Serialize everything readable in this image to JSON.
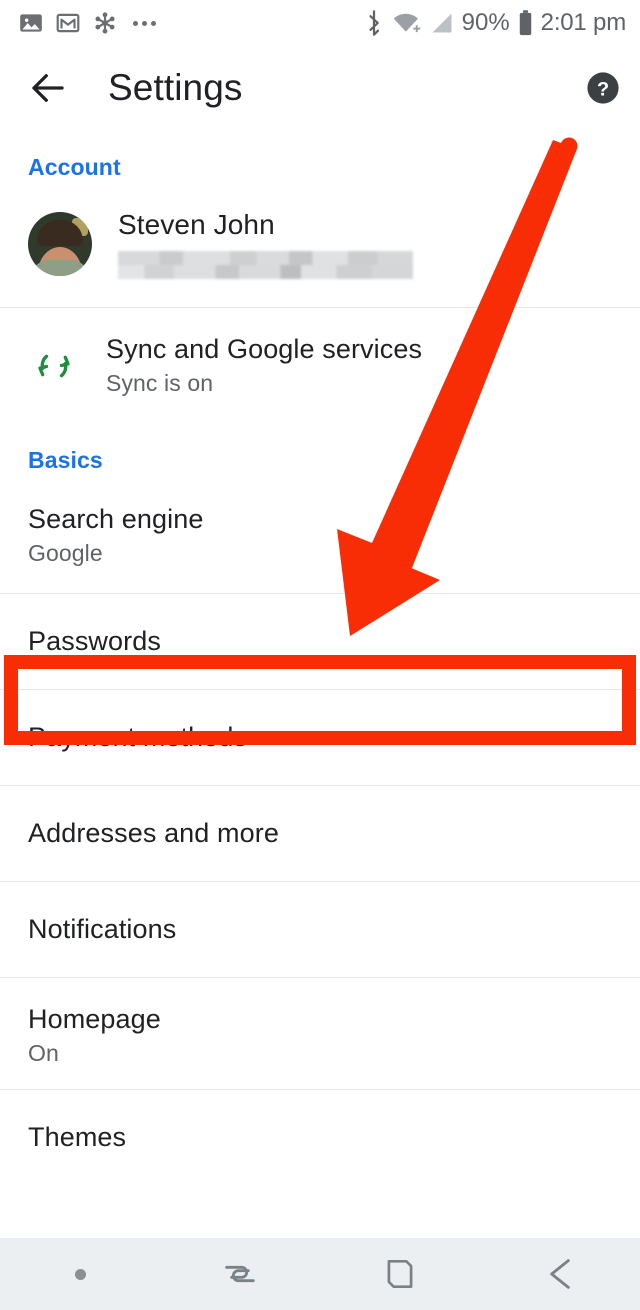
{
  "statusbar": {
    "left_icons": [
      "photos-icon",
      "gmail-icon",
      "asterisk-app-icon",
      "more-notifications-icon"
    ],
    "right_icons": [
      "bluetooth-icon",
      "wifi-plus-icon",
      "cellular-signal-icon",
      "battery-icon"
    ],
    "battery_percent": "90%",
    "time": "2:01 pm"
  },
  "appbar": {
    "back_icon": "arrow-left-icon",
    "title": "Settings",
    "help_icon": "help-circle-icon"
  },
  "sections": {
    "account": {
      "header": "Account",
      "profile": {
        "name": "Steven John",
        "email": "",
        "email_redacted": true,
        "avatar": "user-avatar-photo"
      },
      "sync": {
        "icon": "sync-icon",
        "title": "Sync and Google services",
        "subtitle": "Sync is on"
      }
    },
    "basics": {
      "header": "Basics",
      "items": [
        {
          "title": "Search engine",
          "subtitle": "Google"
        },
        {
          "title": "Passwords",
          "subtitle": ""
        },
        {
          "title": "Payment methods",
          "subtitle": ""
        },
        {
          "title": "Addresses and more",
          "subtitle": ""
        },
        {
          "title": "Notifications",
          "subtitle": ""
        },
        {
          "title": "Homepage",
          "subtitle": "On"
        },
        {
          "title": "Themes",
          "subtitle": ""
        }
      ]
    }
  },
  "annotations": {
    "highlight_target": "Passwords",
    "highlight_color": "#f92d05",
    "arrow_color": "#f92d05",
    "arrow_points_to": "Passwords"
  },
  "navbar": {
    "items": [
      "nav-dot-indicator",
      "recents-icon",
      "home-icon",
      "back-icon"
    ]
  },
  "colors": {
    "accent_blue": "#1a73e8",
    "sync_green": "#1e8e3e",
    "primary_text": "#202124",
    "secondary_text": "#5f6368",
    "annotation_red": "#f92d05",
    "navbar_bg": "#eceff1"
  }
}
